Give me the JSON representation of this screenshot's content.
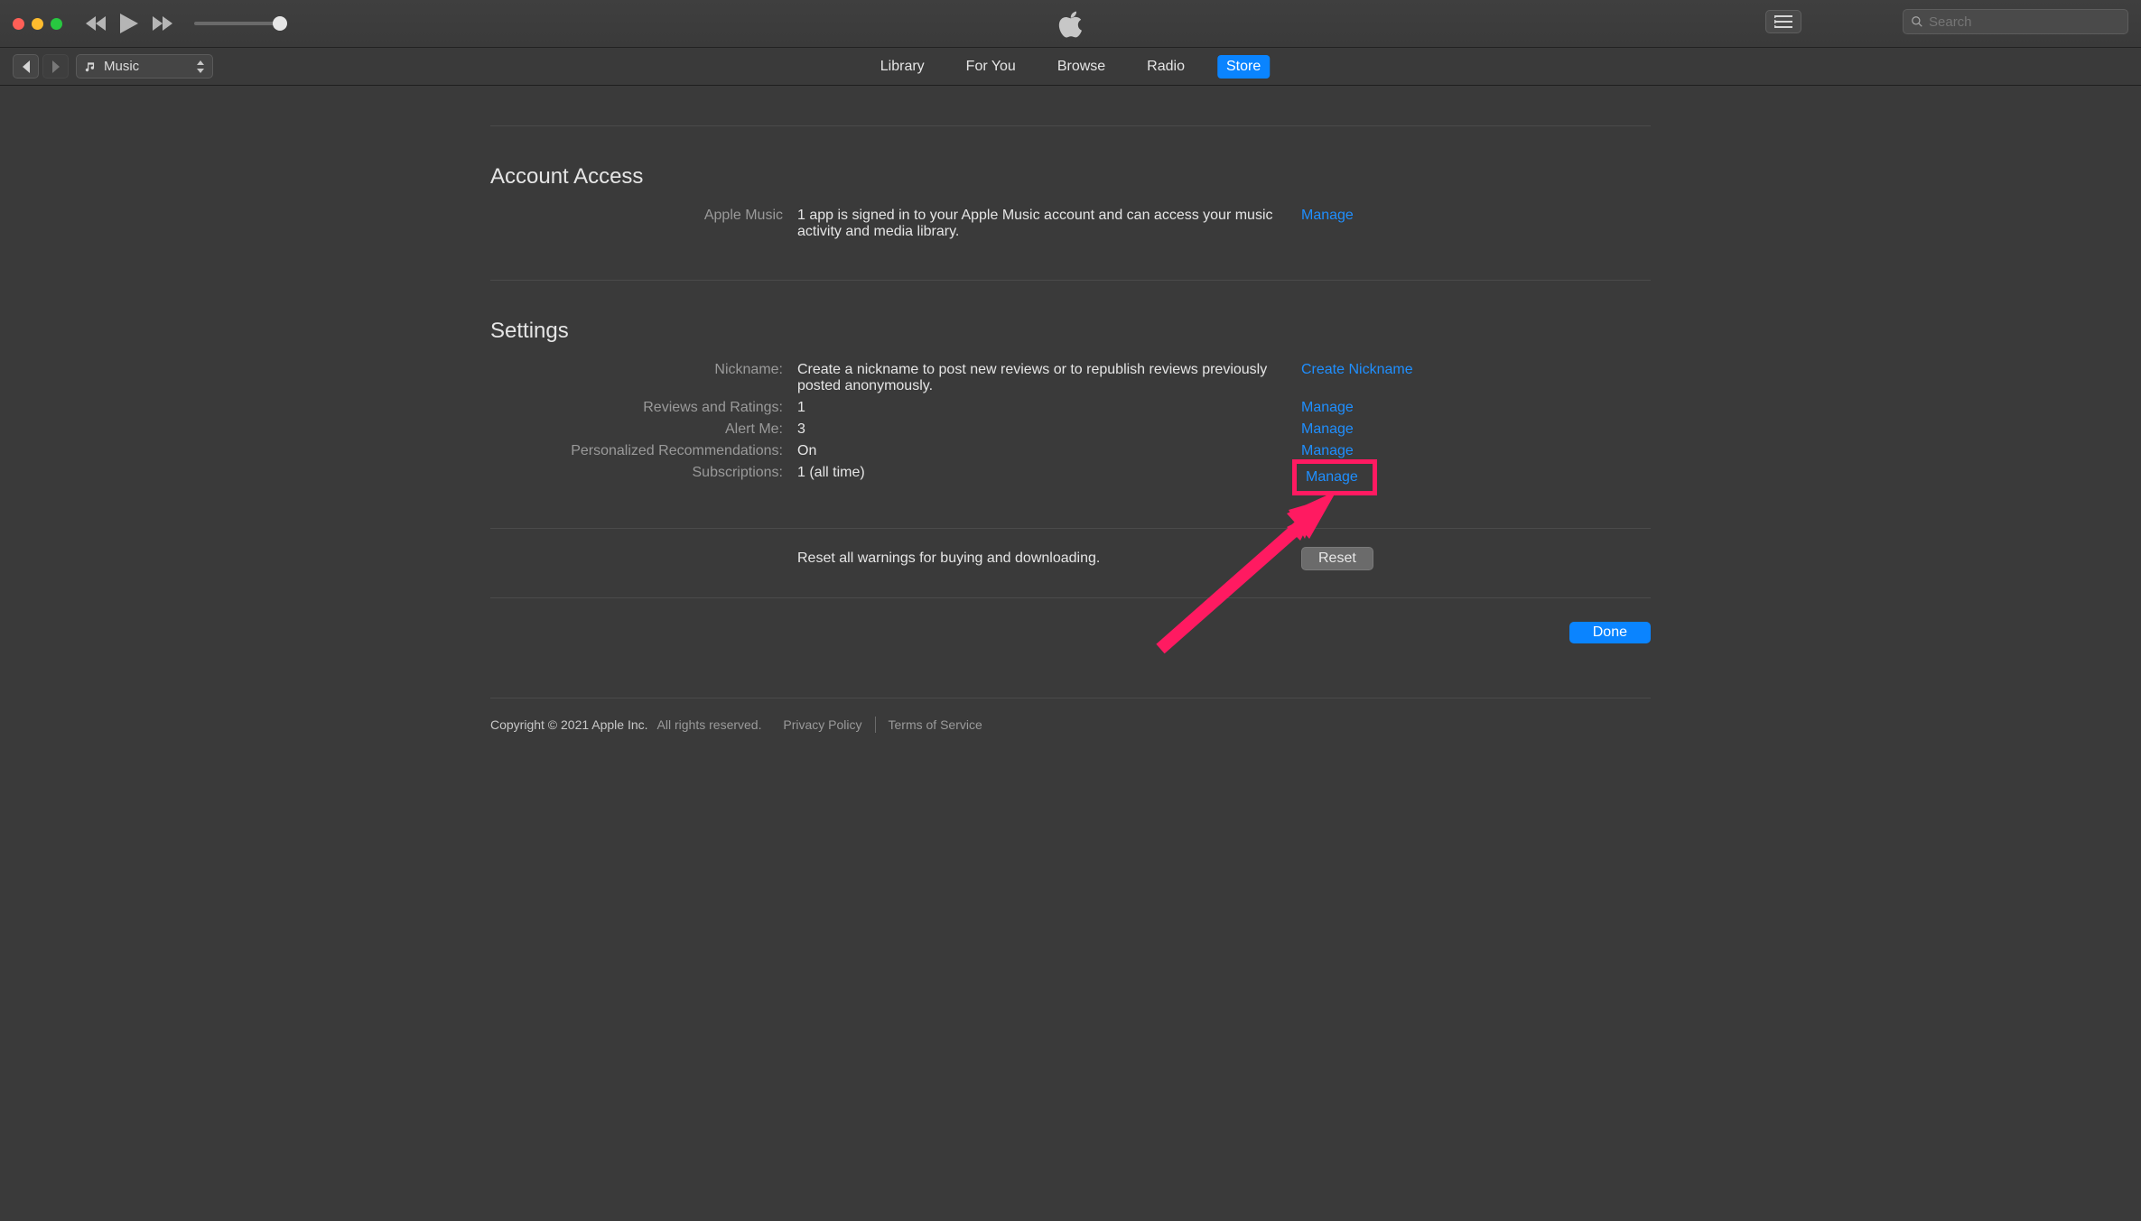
{
  "titlebar": {
    "search_placeholder": "Search"
  },
  "mediaSelector": {
    "label": "Music"
  },
  "tabs": {
    "library": "Library",
    "foryou": "For You",
    "browse": "Browse",
    "radio": "Radio",
    "store": "Store"
  },
  "accountAccess": {
    "heading": "Account Access",
    "appleMusicLabel": "Apple Music",
    "appleMusicDesc": "1 app is signed in to your Apple Music account and can access your music activity and media library.",
    "manage": "Manage"
  },
  "settings": {
    "heading": "Settings",
    "nicknameLabel": "Nickname:",
    "nicknameDesc": "Create a nickname to post new reviews or to republish reviews previously posted anonymously.",
    "createNickname": "Create Nickname",
    "reviewsLabel": "Reviews and Ratings:",
    "reviewsValue": "1",
    "manage": "Manage",
    "alertLabel": "Alert Me:",
    "alertValue": "3",
    "persLabel": "Personalized Recommendations:",
    "persValue": "On",
    "subsLabel": "Subscriptions:",
    "subsValue": "1 (all time)",
    "resetDesc": "Reset all warnings for buying and downloading.",
    "resetBtn": "Reset",
    "doneBtn": "Done"
  },
  "footer": {
    "copyright": "Copyright © 2021 Apple Inc.",
    "rights": "All rights reserved.",
    "privacy": "Privacy Policy",
    "terms": "Terms of Service"
  }
}
